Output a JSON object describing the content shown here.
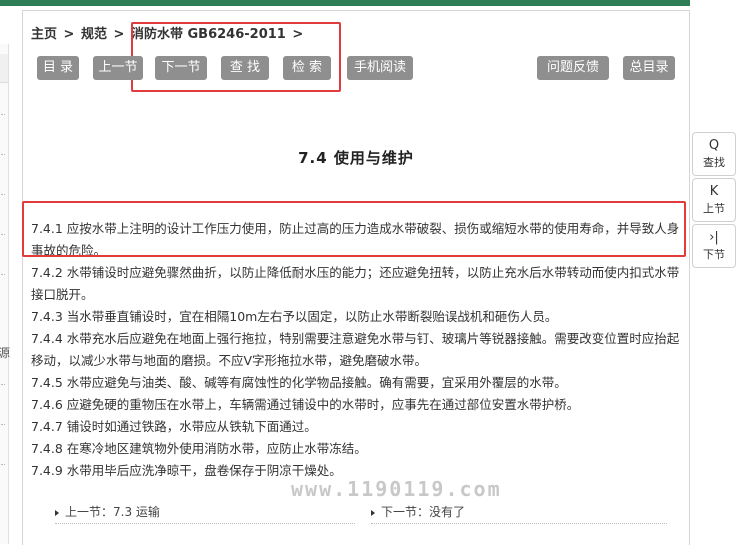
{
  "breadcrumb": {
    "home": "主页",
    "sep1": ">",
    "section": "规范",
    "sep2": ">",
    "document": "消防水带 GB6246-2011",
    "sep3": ">"
  },
  "toolbar": {
    "buttons": [
      "目 录",
      "上一节",
      "下一节",
      "查 找",
      "检 索",
      "手机阅读"
    ],
    "right_buttons": [
      "问题反馈",
      "总目录"
    ]
  },
  "heading": "7.4 使用与维护",
  "clauses": [
    "7.4.1 应按水带上注明的设计工作压力使用，防止过高的压力造成水带破裂、损伤或缩短水带的使用寿命，并导致人身事故的危险。",
    "7.4.2 水带铺设时应避免骤然曲折，以防止降低耐水压的能力；还应避免扭转，以防止充水后水带转动而使内扣式水带接口脱开。",
    "7.4.3 当水带垂直铺设时，宜在相隔10m左右予以固定，以防止水带断裂贻误战机和砸伤人员。",
    "7.4.4 水带充水后应避免在地面上强行拖拉，特别需要注意避免水带与钉、玻璃片等锐器接触。需要改变位置时应抬起移动，以减少水带与地面的磨损。不应V字形拖拉水带，避免磨破水带。",
    "7.4.5 水带应避免与油类、酸、碱等有腐蚀性的化学物品接触。确有需要，宜采用外覆层的水带。",
    "7.4.6 应避免硬的重物压在水带上，车辆需通过铺设中的水带时，应事先在通过部位安置水带护桥。",
    "7.4.7 铺设时如通过铁路，水带应从铁轨下面通过。",
    "7.4.8 在寒冷地区建筑物外使用消防水带，应防止水带冻结。",
    "7.4.9 水带用毕后应洗净晾干，盘卷保存于阴凉干燥处。"
  ],
  "watermark": "www.1190119.com",
  "prev": "上一节：7.3 运输",
  "next": "下一节：没有了",
  "side_tools": [
    {
      "icon": "Q",
      "label": "查找"
    },
    {
      "icon": "K",
      "label": "上节"
    },
    {
      "icon": "›|",
      "label": "下节"
    }
  ],
  "left_glyph": "源",
  "colors": {
    "topbar": "#2e7d55",
    "button": "#8f8f8f",
    "highlight_box": "#e23b3b"
  }
}
